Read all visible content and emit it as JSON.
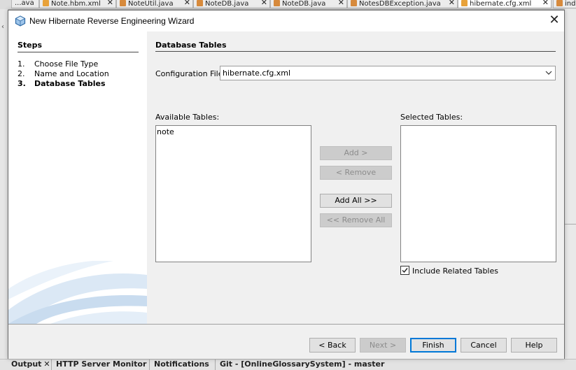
{
  "ide": {
    "editor_tabs": [
      {
        "label": "...ava",
        "icon": "none"
      },
      {
        "label": "Note.hbm.xml",
        "icon": "xml-file-icon"
      },
      {
        "label": "NoteUtil.java",
        "icon": "java-file-icon"
      },
      {
        "label": "NoteDB.java",
        "icon": "java-file-icon"
      },
      {
        "label": "NoteDB.java",
        "icon": "java-file-icon"
      },
      {
        "label": "NotesDBException.java",
        "icon": "java-file-icon"
      },
      {
        "label": "hibernate.cfg.xml",
        "icon": "xml-file-icon"
      },
      {
        "label": "ind",
        "icon": "java-file-icon"
      }
    ],
    "close_glyph": "✕",
    "bottom_tabs": [
      {
        "label": "Output",
        "closable": true
      },
      {
        "label": "HTTP Server Monitor",
        "closable": false
      },
      {
        "label": "Notifications",
        "closable": false
      },
      {
        "label": "Git -  [OnlineGlossarySystem] - master",
        "closable": false
      }
    ]
  },
  "dialog": {
    "title": "New Hibernate Reverse Engineering Wizard",
    "close_glyph": "✕",
    "steps": {
      "heading": "Steps",
      "items": [
        {
          "num": "1.",
          "label": "Choose File Type"
        },
        {
          "num": "2.",
          "label": "Name and Location"
        },
        {
          "num": "3.",
          "label": "Database Tables"
        }
      ]
    },
    "panel": {
      "heading": "Database Tables",
      "config_label": "Configuration File:",
      "config_value": "hibernate.cfg.xml",
      "available_label": "Available Tables:",
      "available_items": [
        "note"
      ],
      "selected_label": "Selected Tables:",
      "selected_items": [],
      "add_label": "Add >",
      "remove_label": "< Remove",
      "add_all_label": "Add All >>",
      "remove_all_label": "<< Remove All",
      "include_related_label": "Include Related Tables",
      "include_related_checked": true
    },
    "buttons": {
      "back": "< Back",
      "next": "Next >",
      "finish": "Finish",
      "cancel": "Cancel",
      "help": "Help"
    }
  },
  "colors": {
    "accent": "#0078d7",
    "swoosh": "#c9dcef"
  }
}
